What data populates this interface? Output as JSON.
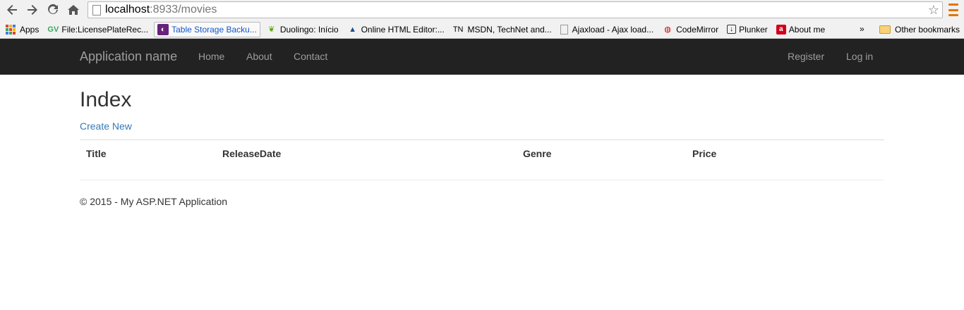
{
  "browser": {
    "url_host": "localhost",
    "url_path": ":8933/movies",
    "bookmarks": [
      {
        "label": "Apps"
      },
      {
        "label": "File:LicensePlateRec..."
      },
      {
        "label": "Table Storage Backu..."
      },
      {
        "label": "Duolingo: Início"
      },
      {
        "label": "Online HTML Editor:..."
      },
      {
        "label": "MSDN, TechNet and..."
      },
      {
        "label": "Ajaxload - Ajax load..."
      },
      {
        "label": "CodeMirror"
      },
      {
        "label": "Plunker"
      },
      {
        "label": "About me"
      }
    ],
    "more": "»",
    "other_bookmarks": "Other bookmarks",
    "tn_prefix": "TN"
  },
  "navbar": {
    "brand": "Application name",
    "links": [
      "Home",
      "About",
      "Contact"
    ],
    "right_links": [
      "Register",
      "Log in"
    ]
  },
  "main": {
    "title": "Index",
    "create_link": "Create New",
    "columns": [
      "Title",
      "ReleaseDate",
      "Genre",
      "Price"
    ]
  },
  "footer": {
    "text": "© 2015 - My ASP.NET Application"
  },
  "colors": {
    "navbar_bg": "#222222",
    "link": "#337ab7"
  }
}
